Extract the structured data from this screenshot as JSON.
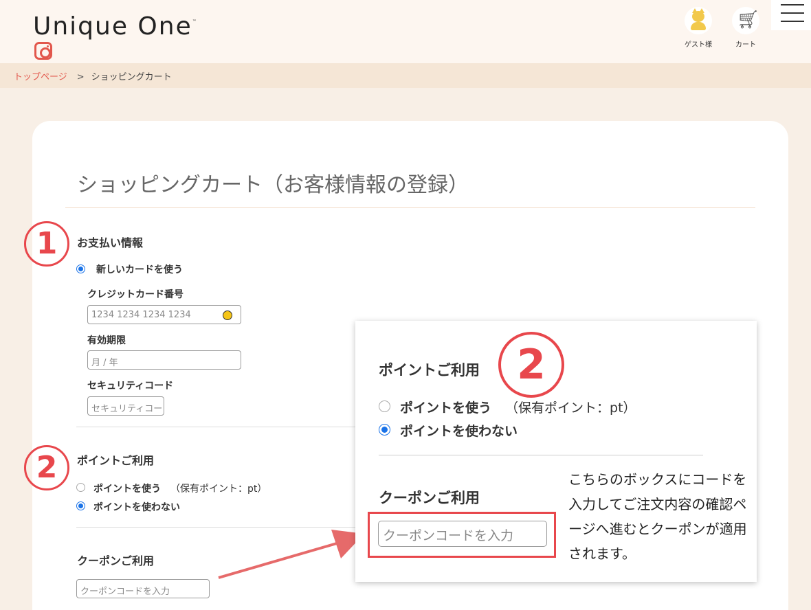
{
  "header": {
    "logo": "Unique One",
    "logo_tm": "™",
    "instagram_icon": "instagram-icon",
    "guest_label": "ゲスト様",
    "cart_label": "カート",
    "menu_icon": "hamburger-menu-icon"
  },
  "breadcrumb": {
    "home": "トップページ",
    "separator": ">",
    "current": "ショッピングカート"
  },
  "page": {
    "title": "ショッピングカート（お客様情報の登録）"
  },
  "markers": {
    "one": "1",
    "two": "2"
  },
  "payment": {
    "title": "お支払い情報",
    "new_card_label": "新しいカードを使う",
    "card_number_label": "クレジットカード番号",
    "card_number_placeholder": "1234 1234 1234 1234",
    "expiry_label": "有効期限",
    "expiry_placeholder": "月 / 年",
    "cvc_label": "セキュリティコード",
    "cvc_placeholder": "セキュリティコード"
  },
  "points": {
    "title": "ポイントご利用",
    "use_label": "ポイントを使う",
    "balance_label": "（保有ポイント：pt）",
    "no_use_label": "ポイントを使わない"
  },
  "coupon": {
    "title": "クーポンご利用",
    "placeholder": "クーポンコードを入力"
  },
  "zoom": {
    "note": "こちらのボックスにコードを入力してご注文内容の確認ページへ進むとクーポンが適用されます。"
  },
  "colors": {
    "accent_red": "#e8474c",
    "radio_blue": "#1a73e8",
    "header_bg": "#fdf6f0",
    "breadcrumb_bg": "#f5e6d6"
  }
}
